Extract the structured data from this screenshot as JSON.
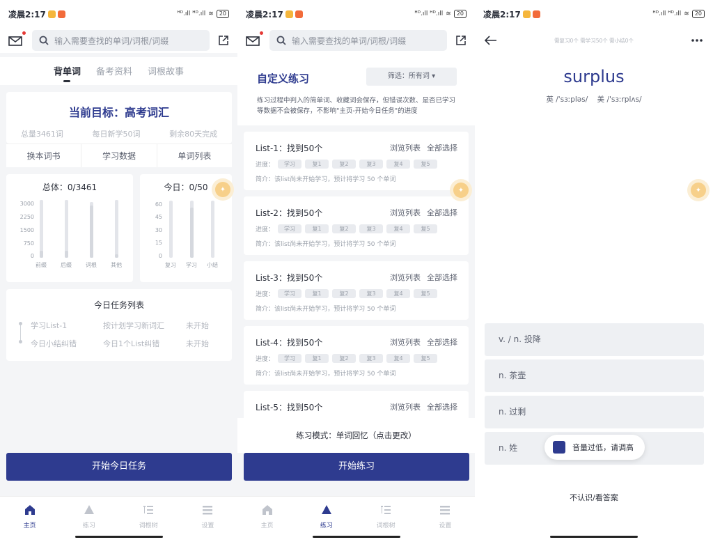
{
  "status": {
    "time": "凌晨2:17",
    "signal": "ᴴᴰ.ıll ᴴᴰ.ıll",
    "battery": "20"
  },
  "search": {
    "placeholder": "输入需要查找的单词/词根/词缀"
  },
  "screen1": {
    "tabs": [
      "背单词",
      "备考资料",
      "词根故事"
    ],
    "goal": {
      "title": "当前目标：高考词汇",
      "total": "总量3461词",
      "daily": "每日新学50词",
      "remaining": "剩余80天完成"
    },
    "actions": [
      "换本词书",
      "学习数据",
      "单词列表"
    ],
    "overall": {
      "title": "总体：0/3461",
      "yticks": [
        "3000",
        "2250",
        "1500",
        "750",
        "0"
      ],
      "cats": [
        "前缀",
        "后缀",
        "词根",
        "其他"
      ]
    },
    "today": {
      "title": "今日：0/50",
      "yticks": [
        "60",
        "45",
        "30",
        "15",
        "0"
      ],
      "cats": [
        "复习",
        "学习",
        "小结"
      ]
    },
    "tasks": {
      "title": "今日任务列表",
      "rows": [
        {
          "name": "学习List-1",
          "desc": "按计划学习新词汇",
          "status": "未开始"
        },
        {
          "name": "今日小结纠错",
          "desc": "今日1个List纠错",
          "status": "未开始"
        }
      ]
    },
    "start_button": "开始今日任务"
  },
  "screen2": {
    "title": "自定义练习",
    "filter": "筛选：所有词 ▾",
    "desc": "练习过程中判入的简单词、收藏词会保存，但错误次数、是否已学习等数据不会被保存，不影响\"主页-开始今日任务\"的进度",
    "progress_label": "进度：",
    "chips": [
      "学习",
      "复1",
      "复2",
      "复3",
      "复4",
      "复5"
    ],
    "browse": "浏览列表",
    "select_all": "全部选择",
    "lists": [
      {
        "title": "List-1：找到50个",
        "intro": "简介：该list尚未开始学习，预计将学习 50 个单词"
      },
      {
        "title": "List-2：找到50个",
        "intro": "简介：该list尚未开始学习，预计将学习 50 个单词"
      },
      {
        "title": "List-3：找到50个",
        "intro": "简介：该list尚未开始学习，预计将学习 50 个单词"
      },
      {
        "title": "List-4：找到50个",
        "intro": "简介：该list尚未开始学习，预计将学习 50 个单词"
      },
      {
        "title": "List-5：找到50个",
        "intro": ""
      }
    ],
    "mode": "练习模式：单词回忆（点击更改）",
    "start_button": "开始练习"
  },
  "screen3": {
    "stats": "需复习0个 需学习50个 需小结0个",
    "word": "surplus",
    "uk": "英 /'sɜːpləs/",
    "us": "美 /'sɜːrplʌs/",
    "options": [
      "v. / n. 投降",
      "n. 茶壶",
      "n. 过剩",
      "n. 姓"
    ],
    "toast": "音量过低，请调高",
    "dont_know": "不认识/看答案"
  },
  "nav": [
    "主页",
    "练习",
    "词根树",
    "设置"
  ],
  "colors": {
    "primary": "#2e3b8f",
    "accent": "#f7d08a"
  }
}
